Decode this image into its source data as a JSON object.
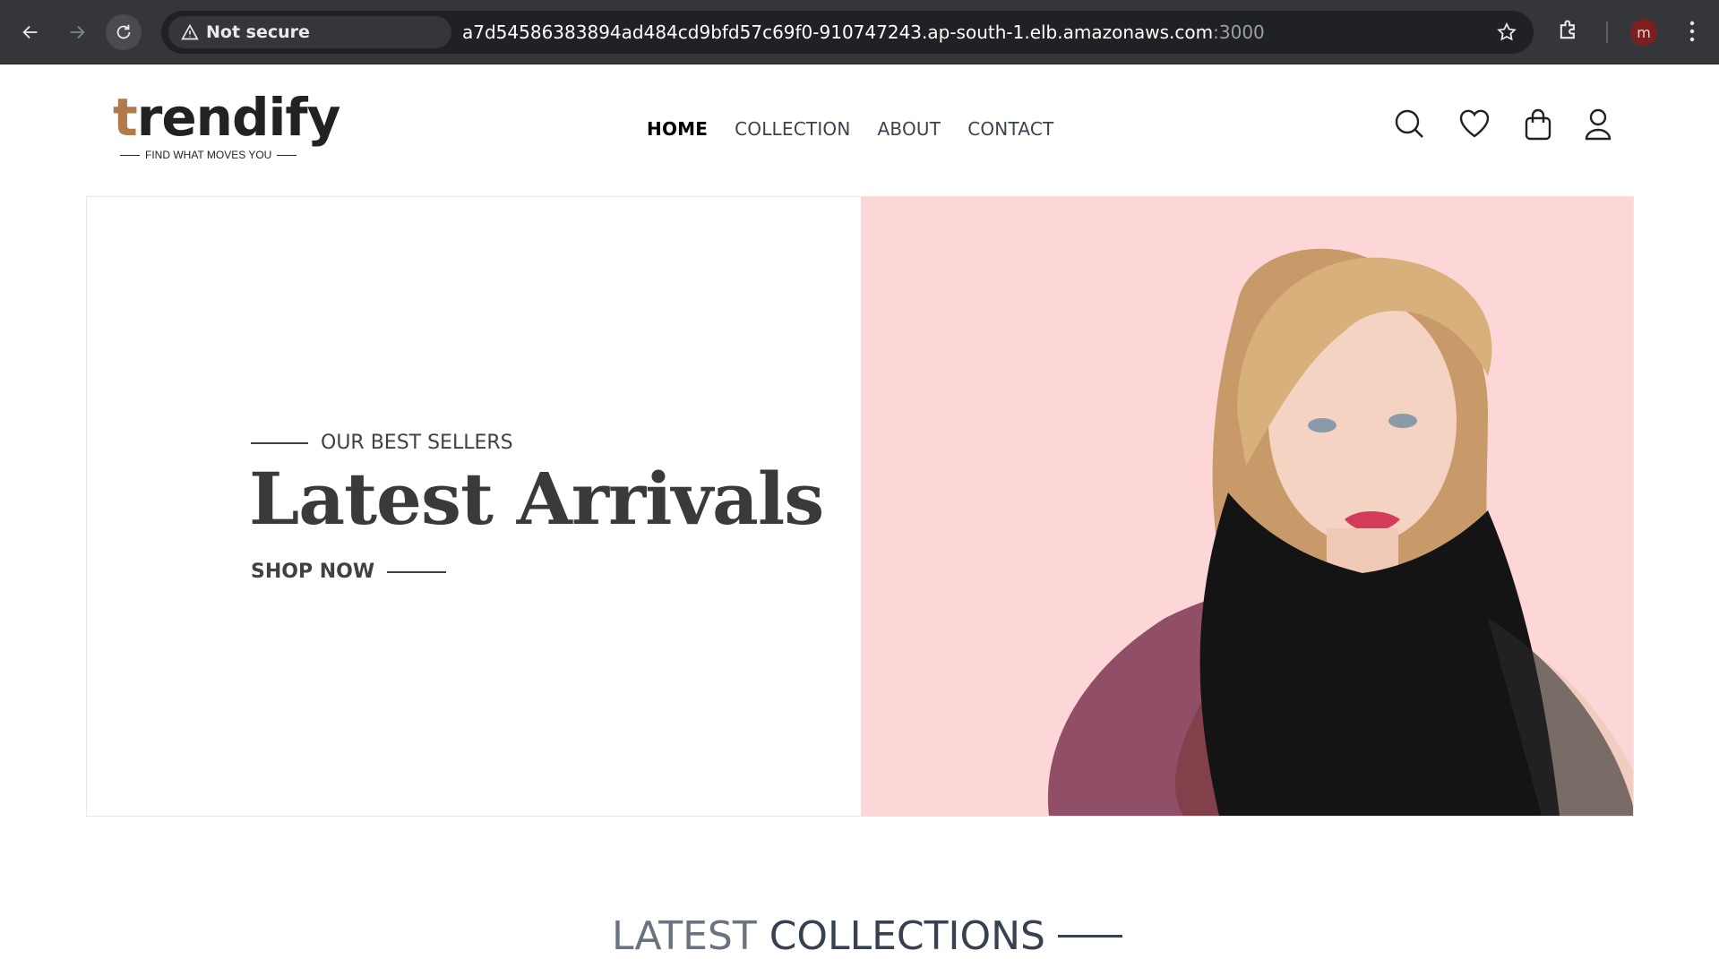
{
  "browser": {
    "security_label": "Not secure",
    "url_host": "a7d54586383894ad484cd9bfd57c69f0-910747243.ap-south-1.elb.amazonaws.com",
    "url_port": ":3000",
    "profile_initial": "m"
  },
  "site": {
    "logo_text": "rendify",
    "logo_first_letter": "t",
    "logo_tagline": "FIND WHAT MOVES YOU",
    "nav": [
      {
        "label": "HOME"
      },
      {
        "label": "COLLECTION"
      },
      {
        "label": "ABOUT"
      },
      {
        "label": "CONTACT"
      }
    ],
    "icons": [
      "search-icon",
      "heart-icon",
      "bag-icon",
      "user-icon"
    ]
  },
  "hero": {
    "eyebrow": "OUR BEST SELLERS",
    "title": "Latest Arrivals",
    "cta": "SHOP NOW",
    "image_bg": "#fdd7d7"
  },
  "collections": {
    "title_part1": "LATEST",
    "title_part2": "COLLECTIONS"
  },
  "colors": {
    "chrome_bg": "#35363a",
    "omnibox_bg": "#202124",
    "text_dark": "#414141",
    "logo_accent": "#b07a4a"
  }
}
